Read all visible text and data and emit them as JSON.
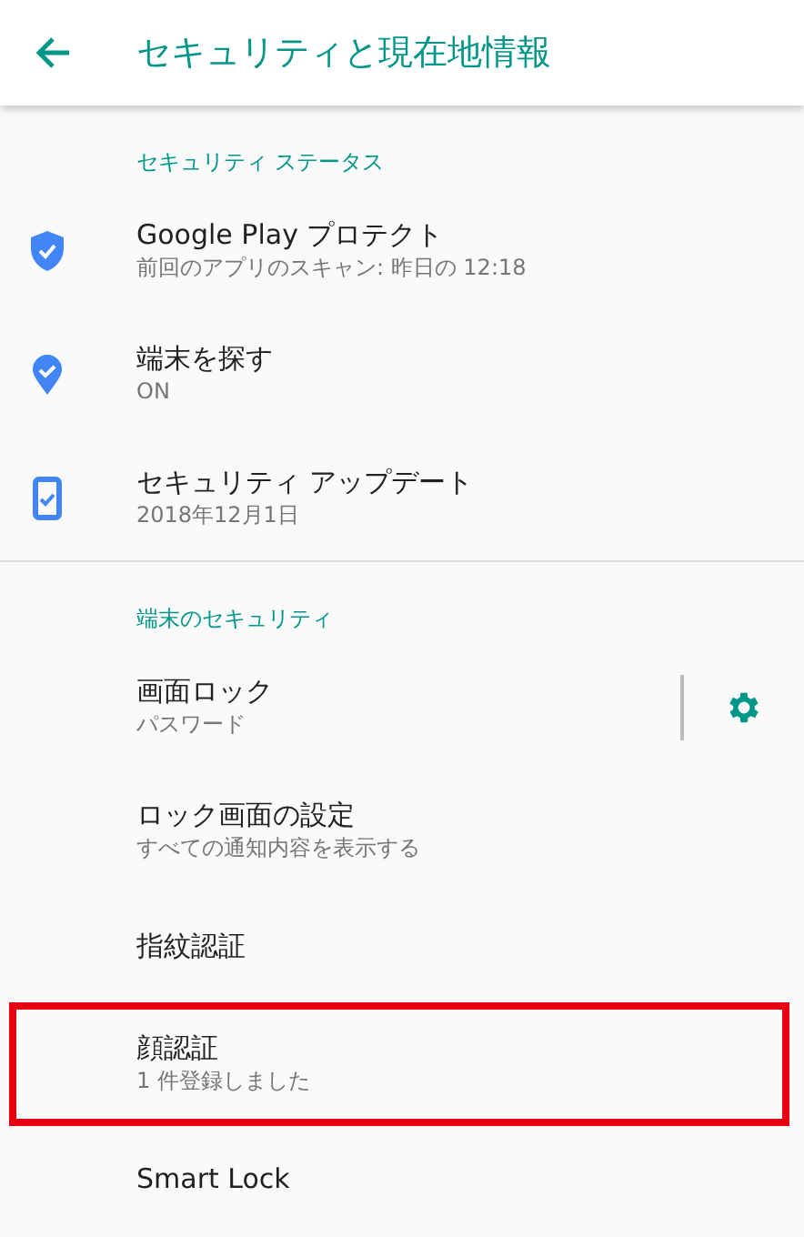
{
  "app_bar": {
    "title": "セキュリティと現在地情報"
  },
  "sections": [
    {
      "header": "セキュリティ ステータス",
      "items": [
        {
          "kind": "shield",
          "title": "Google Play プロテクト",
          "summary": "前回のアプリのスキャン: 昨日の 12:18",
          "highlighted": false
        },
        {
          "kind": "pin",
          "title": "端末を探す",
          "summary": "ON",
          "highlighted": false
        },
        {
          "kind": "phone",
          "title": "セキュリティ アップデート",
          "summary": "2018年12月1日",
          "highlighted": false
        }
      ]
    },
    {
      "header": "端末のセキュリティ",
      "items": [
        {
          "kind": "settings",
          "title": "画面ロック",
          "summary": "パスワード",
          "highlighted": false
        },
        {
          "kind": "plain",
          "title": "ロック画面の設定",
          "summary": "すべての通知内容を表示する",
          "highlighted": false
        },
        {
          "kind": "plain",
          "title": "指紋認証",
          "highlighted": false
        },
        {
          "kind": "plain",
          "title": "顔認証",
          "summary": "1 件登録しました",
          "highlighted": true
        },
        {
          "kind": "plain",
          "title": "Smart Lock",
          "highlighted": false
        }
      ]
    }
  ]
}
